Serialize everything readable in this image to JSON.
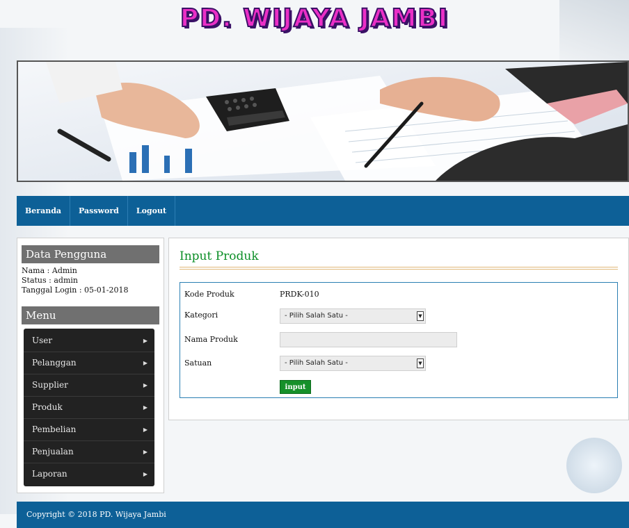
{
  "site": {
    "title": "PD. WIJAYA JAMBI"
  },
  "nav": {
    "items": [
      "Beranda",
      "Password",
      "Logout"
    ]
  },
  "sidebar": {
    "user_heading": "Data Pengguna",
    "user_info": {
      "nama": "Nama : Admin",
      "status": "Status : admin",
      "login": "Tanggal Login : 05-01-2018"
    },
    "menu_heading": "Menu",
    "menu_items": [
      "User",
      "Pelanggan",
      "Supplier",
      "Produk",
      "Pembelian",
      "Penjualan",
      "Laporan"
    ]
  },
  "main": {
    "title": "Input Produk",
    "form": {
      "kode_label": "Kode Produk",
      "kode_value": "PRDK-010",
      "kategori_label": "Kategori",
      "kategori_selected": "- Pilih Salah Satu -",
      "nama_label": "Nama Produk",
      "nama_value": "",
      "satuan_label": "Satuan",
      "satuan_selected": "- Pilih Salah Satu -",
      "submit_label": "input"
    }
  },
  "footer": {
    "text": "Copyright © 2018 PD. Wijaya Jambi"
  },
  "colors": {
    "nav": "#0d6097",
    "accent_green": "#0b8e26",
    "menu_bg": "#222222"
  }
}
